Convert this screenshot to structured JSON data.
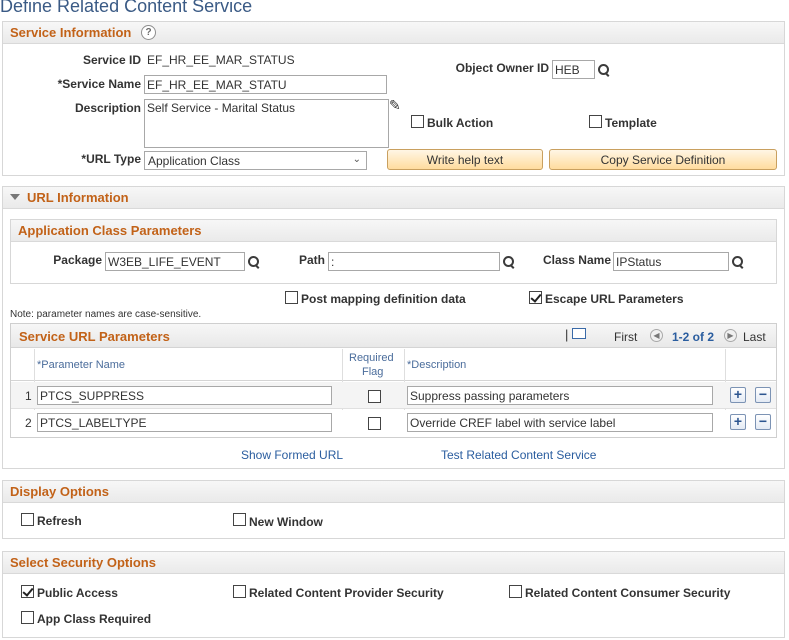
{
  "page_title": "Define Related Content Service",
  "service_info": {
    "header": "Service Information",
    "service_id_label": "Service ID",
    "service_id_value": "EF_HR_EE_MAR_STATUS",
    "service_name_label": "*Service Name",
    "service_name_value": "EF_HR_EE_MAR_STATU",
    "object_owner_label": "Object Owner ID",
    "object_owner_value": "HEB",
    "description_label": "Description",
    "description_value": "Self Service - Marital Status",
    "bulk_action_label": "Bulk Action",
    "template_label": "Template",
    "url_type_label": "*URL Type",
    "url_type_value": "Application Class",
    "write_help_label": "Write help text",
    "copy_def_label": "Copy Service Definition"
  },
  "url_info": {
    "header": "URL Information",
    "app_class_header": "Application Class Parameters",
    "package_label": "Package",
    "package_value": "W3EB_LIFE_EVENT",
    "path_label": "Path",
    "path_value": ":",
    "class_name_label": "Class Name",
    "class_name_value": "IPStatus",
    "post_mapping_label": "Post mapping definition data",
    "escape_url_label": "Escape URL Parameters",
    "note": "Note: parameter names are case-sensitive.",
    "grid": {
      "title": "Service URL Parameters",
      "first_label": "First",
      "range_label": "1-2 of 2",
      "last_label": "Last",
      "col_param_name": "*Parameter Name",
      "col_required_1": "Required",
      "col_required_2": "Flag",
      "col_description": "*Description",
      "rows": [
        {
          "num": "1",
          "param": "PTCS_SUPPRESS",
          "required": false,
          "desc": "Suppress passing parameters"
        },
        {
          "num": "2",
          "param": "PTCS_LABELTYPE",
          "required": false,
          "desc": "Override CREF label with service label"
        }
      ]
    },
    "show_formed_url": "Show Formed URL",
    "test_related": "Test Related Content Service"
  },
  "display_options": {
    "header": "Display Options",
    "refresh_label": "Refresh",
    "new_window_label": "New Window"
  },
  "security": {
    "header": "Select Security Options",
    "public_access_label": "Public Access",
    "provider_security_label": "Related Content Provider Security",
    "consumer_security_label": "Related Content Consumer Security",
    "app_class_required_label": "App Class Required"
  },
  "icons": {
    "help": "?",
    "plus": "+",
    "minus": "−",
    "chevron": "⌄",
    "prev": "◀",
    "next": "▶",
    "separator": "|"
  }
}
